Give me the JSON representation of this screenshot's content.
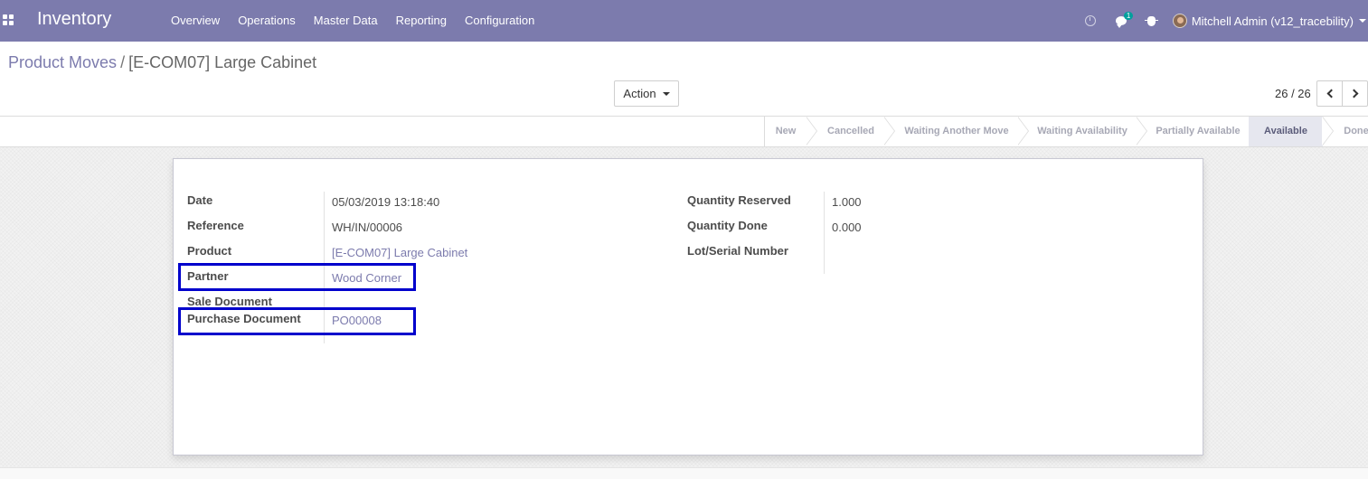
{
  "navbar": {
    "app_name": "Inventory",
    "menu": [
      "Overview",
      "Operations",
      "Master Data",
      "Reporting",
      "Configuration"
    ],
    "chat_badge": "1",
    "user_name": "Mitchell Admin (v12_tracebility)",
    "color": "#7c7bad"
  },
  "breadcrumb": {
    "parent": "Product Moves",
    "separator": "/",
    "current": "[E-COM07] Large Cabinet"
  },
  "toolbar": {
    "action_label": "Action",
    "pager": "26 / 26"
  },
  "statusbar": {
    "steps": [
      "New",
      "Cancelled",
      "Waiting Another Move",
      "Waiting Availability",
      "Partially Available",
      "Available",
      "Done"
    ],
    "active": "Available"
  },
  "form": {
    "left": {
      "date_label": "Date",
      "date_value": "05/03/2019 13:18:40",
      "reference_label": "Reference",
      "reference_value": "WH/IN/00006",
      "product_label": "Product",
      "product_value": "[E-COM07] Large Cabinet",
      "partner_label": "Partner",
      "partner_value": "Wood Corner",
      "sale_label": "Sale Document",
      "sale_value": "",
      "purchase_label": "Purchase Document",
      "purchase_value": "PO00008"
    },
    "right": {
      "qty_reserved_label": "Quantity Reserved",
      "qty_reserved_value": "1.000",
      "qty_done_label": "Quantity Done",
      "qty_done_value": "0.000",
      "lot_label": "Lot/Serial Number",
      "lot_value": ""
    }
  },
  "highlight_color": "#0000cc"
}
